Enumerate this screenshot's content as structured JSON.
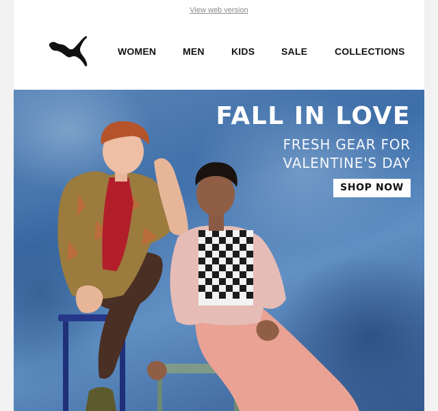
{
  "header": {
    "view_web_version": "View web version",
    "logo_icon": "puma-cat-icon"
  },
  "nav": {
    "items": [
      "WOMEN",
      "MEN",
      "KIDS",
      "SALE",
      "COLLECTIONS"
    ]
  },
  "hero": {
    "headline": "FALL IN LOVE",
    "subline1": "FRESH GEAR FOR",
    "subline2": "VALENTINE'S DAY",
    "cta_label": "SHOP NOW"
  },
  "colors": {
    "page_bg": "#f2f2f2",
    "hero_blue": "#4a79b2",
    "text_dark": "#111111",
    "white": "#ffffff"
  }
}
